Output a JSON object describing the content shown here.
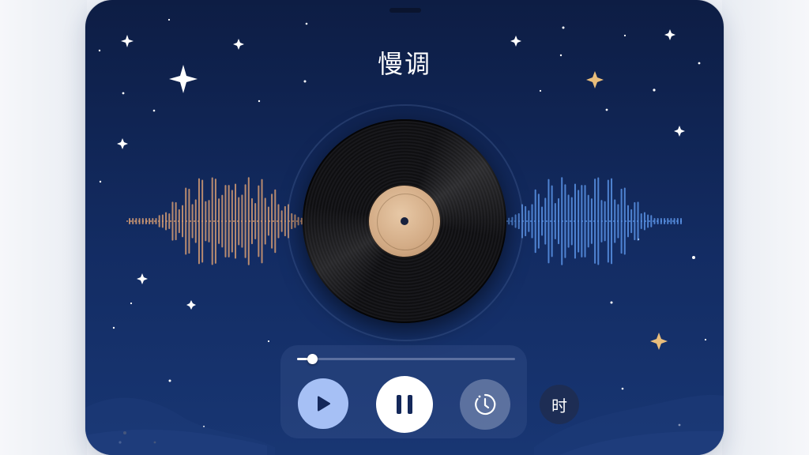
{
  "player": {
    "title": "慢调",
    "progress": 0.07,
    "hour_button_label": "时"
  },
  "icons": {
    "play": "play-icon",
    "pause": "pause-icon",
    "timer": "timer-icon",
    "record": "vinyl-record"
  },
  "colors": {
    "background_top": "#0d1d44",
    "background_bottom": "#183673",
    "wave_left": "#d59c73",
    "wave_right": "#5a93e6",
    "play_button": "#a6c0f5",
    "pause_button": "#ffffff",
    "star_gold": "#e9bd7b"
  }
}
